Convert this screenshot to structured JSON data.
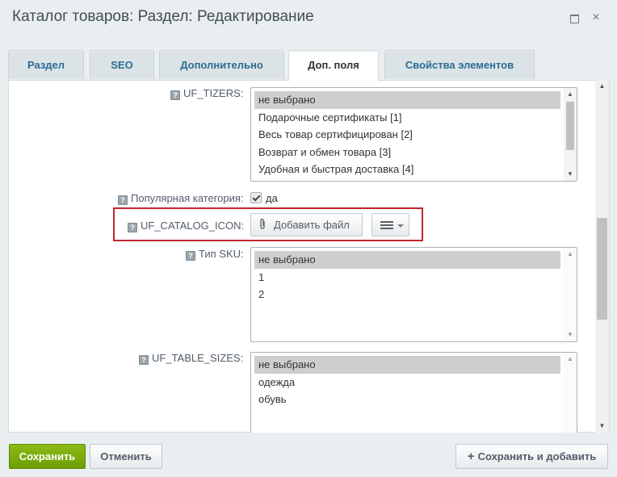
{
  "window": {
    "title": "Каталог товаров: Раздел: Редактирование",
    "maximize_icon": "maximize-icon",
    "close_label": "×"
  },
  "tabs": [
    {
      "label": "Раздел",
      "active": false
    },
    {
      "label": "SEO",
      "active": false
    },
    {
      "label": "Дополнительно",
      "active": false
    },
    {
      "label": "Доп. поля",
      "active": true
    },
    {
      "label": "Свойства элементов",
      "active": false
    }
  ],
  "fields": {
    "uf_tizers": {
      "label": "UF_TIZERS:",
      "options": [
        "не выбрано",
        "Подарочные сертификаты [1]",
        "Весь товар сертифицирован [2]",
        "Возврат и обмен товара [3]",
        "Удобная и быстрая доставка [4]"
      ],
      "selected": "не выбрано"
    },
    "popular_category": {
      "label": "Популярная категория:",
      "value_label": "да",
      "checked": true
    },
    "uf_catalog_icon": {
      "label": "UF_CATALOG_ICON:",
      "add_file_label": "Добавить файл",
      "highlight_color": "#c0262d"
    },
    "sku_type": {
      "label": "Тип SKU:",
      "options": [
        "не выбрано",
        "1",
        "2"
      ],
      "selected": "не выбрано"
    },
    "uf_table_sizes": {
      "label": "UF_TABLE_SIZES:",
      "options": [
        "не выбрано",
        "одежда",
        "обувь"
      ],
      "selected": "не выбрано"
    }
  },
  "footer": {
    "save_label": "Сохранить",
    "cancel_label": "Отменить",
    "save_add_label": "Сохранить и добавить",
    "save_color": "#7aab0c"
  },
  "icons": {
    "help": "help-icon",
    "paperclip": "paperclip-icon",
    "menu": "menu-icon",
    "plus": "plus-icon"
  }
}
